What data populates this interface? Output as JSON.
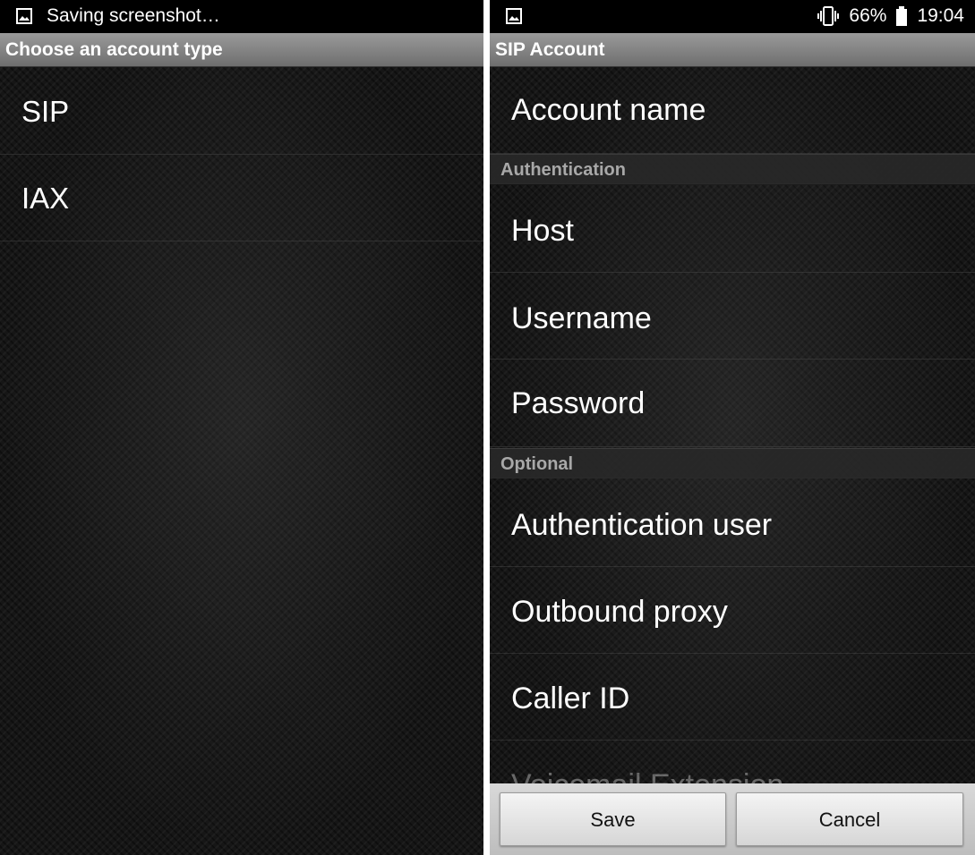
{
  "left": {
    "status_text": "Saving screenshot…",
    "title": "Choose an account type",
    "items": [
      "SIP",
      "IAX"
    ]
  },
  "right": {
    "status": {
      "battery": "66%",
      "time": "19:04"
    },
    "title": "SIP Account",
    "prefs": {
      "account_name": "Account name",
      "auth_category": "Authentication",
      "host": "Host",
      "username": "Username",
      "password": "Password",
      "optional_category": "Optional",
      "auth_user": "Authentication user",
      "outbound_proxy": "Outbound proxy",
      "caller_id": "Caller ID",
      "voicemail_ext": "Voicemail Extension"
    },
    "buttons": {
      "save": "Save",
      "cancel": "Cancel"
    }
  },
  "icons": {
    "gallery": "image-icon",
    "vibrate": "vibrate-icon",
    "battery": "battery-icon"
  }
}
